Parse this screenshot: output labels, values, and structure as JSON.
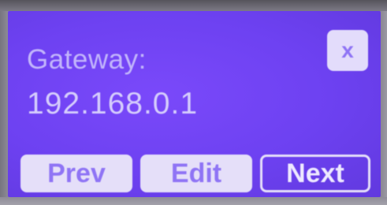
{
  "screen": {
    "field_label": "Gateway:",
    "field_value": "192.168.0.1",
    "close_label": "x",
    "buttons": {
      "prev": "Prev",
      "edit": "Edit",
      "next": "Next"
    }
  },
  "colors": {
    "screen_background": "#6d41f1",
    "button_fill": "#e5dff9",
    "button_text": "#8f74f5",
    "label_text": "#c2b5fb",
    "value_text": "#d5cdfc"
  }
}
